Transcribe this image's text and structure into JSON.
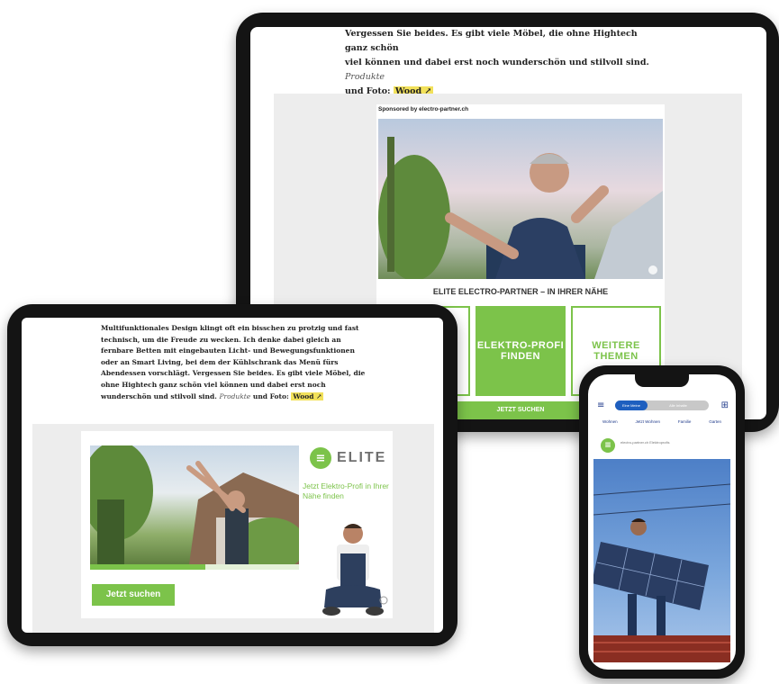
{
  "colors": {
    "accent": "#7cc34a",
    "device_frame": "#141414",
    "ad_background": "#ededed",
    "phone_blue": "#1e5fbf"
  },
  "tablet_large": {
    "article_lines": [
      "Vergessen Sie beides. Es gibt viele Möbel, die ohne Hightech ganz schön",
      "viel können und dabei erst noch wunderschön und stilvoll sind."
    ],
    "credit_prefix": "Produkte",
    "credit_mid": "und Foto:",
    "credit_link": "Wood ↗",
    "sponsor": "Sponsored by electro-partner.ch",
    "ad_title": "ELITE ELECTRO-PARTNER – IN IHRER NÄHE",
    "tiles": [
      "Elektro-Profi finden",
      "Weitere Themen"
    ],
    "cta": "JETZT SUCHEN"
  },
  "tablet_small": {
    "article": "Multifunktionales Design klingt oft ein bisschen zu protzig und fast technisch, um die Freude zu wecken. Ich denke dabei gleich an fernbare Betten mit eingebauten Licht- und Bewegungsfunktionen oder an Smart Living, bei dem der Kühlschrank das Menü fürs Abendessen vorschlägt. Vergessen Sie beides. Es gibt viele Möbel, die ohne Hightech ganz schön viel können und dabei erst noch wunderschön und stilvoll sind.",
    "credit_prefix": "Produkte",
    "credit_mid": "und Foto:",
    "credit_link": "Wood ↗",
    "brand": "ELITE",
    "tagline": "Jetzt Elektro-Profi in Ihrer Nähe finden",
    "progress": 0.55,
    "button": "Jetzt suchen"
  },
  "phone": {
    "menu_icon": "≡",
    "grid_icon": "⊞",
    "toggle": [
      "Eine Meine",
      "Alle Inhalte"
    ],
    "tabs": [
      "Wohnen",
      "Jetzt Wohnen",
      "Familie",
      "Garten"
    ],
    "ad_text": "electro-partner.ch Elektroprofis"
  },
  "icons": [
    "menu-icon",
    "grid-icon",
    "elite-logo-icon",
    "play-icon"
  ]
}
